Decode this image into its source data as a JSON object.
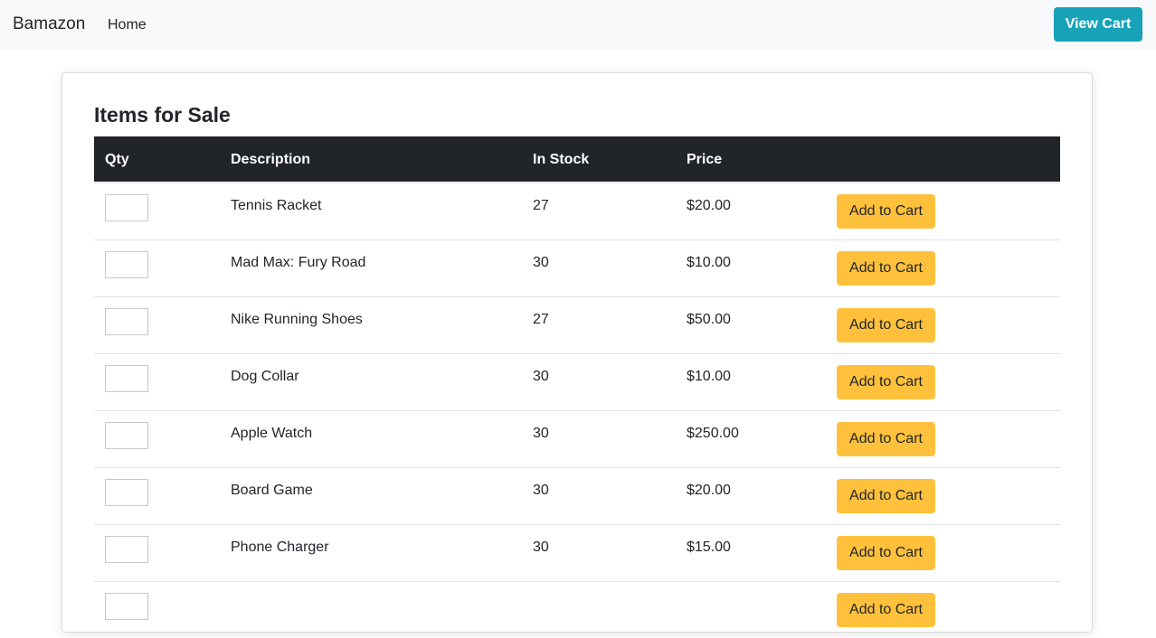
{
  "navbar": {
    "brand": "Bamazon",
    "home_label": "Home",
    "view_cart_label": "View Cart"
  },
  "main": {
    "title": "Items for Sale",
    "columns": [
      "Qty",
      "Description",
      "In Stock",
      "Price"
    ],
    "add_to_cart_label": "Add to Cart",
    "rows": [
      {
        "description": "Tennis Racket",
        "in_stock": "27",
        "price": "$20.00"
      },
      {
        "description": "Mad Max: Fury Road",
        "in_stock": "30",
        "price": "$10.00"
      },
      {
        "description": "Nike Running Shoes",
        "in_stock": "27",
        "price": "$50.00"
      },
      {
        "description": "Dog Collar",
        "in_stock": "30",
        "price": "$10.00"
      },
      {
        "description": "Apple Watch",
        "in_stock": "30",
        "price": "$250.00"
      },
      {
        "description": "Board Game",
        "in_stock": "30",
        "price": "$20.00"
      },
      {
        "description": "Phone Charger",
        "in_stock": "30",
        "price": "$15.00"
      }
    ]
  },
  "colors": {
    "navbar_bg": "#f8f9fa",
    "view_cart_bg": "#17a2b8",
    "table_header_bg": "#212529",
    "add_to_cart_bg": "#ffc13b"
  }
}
